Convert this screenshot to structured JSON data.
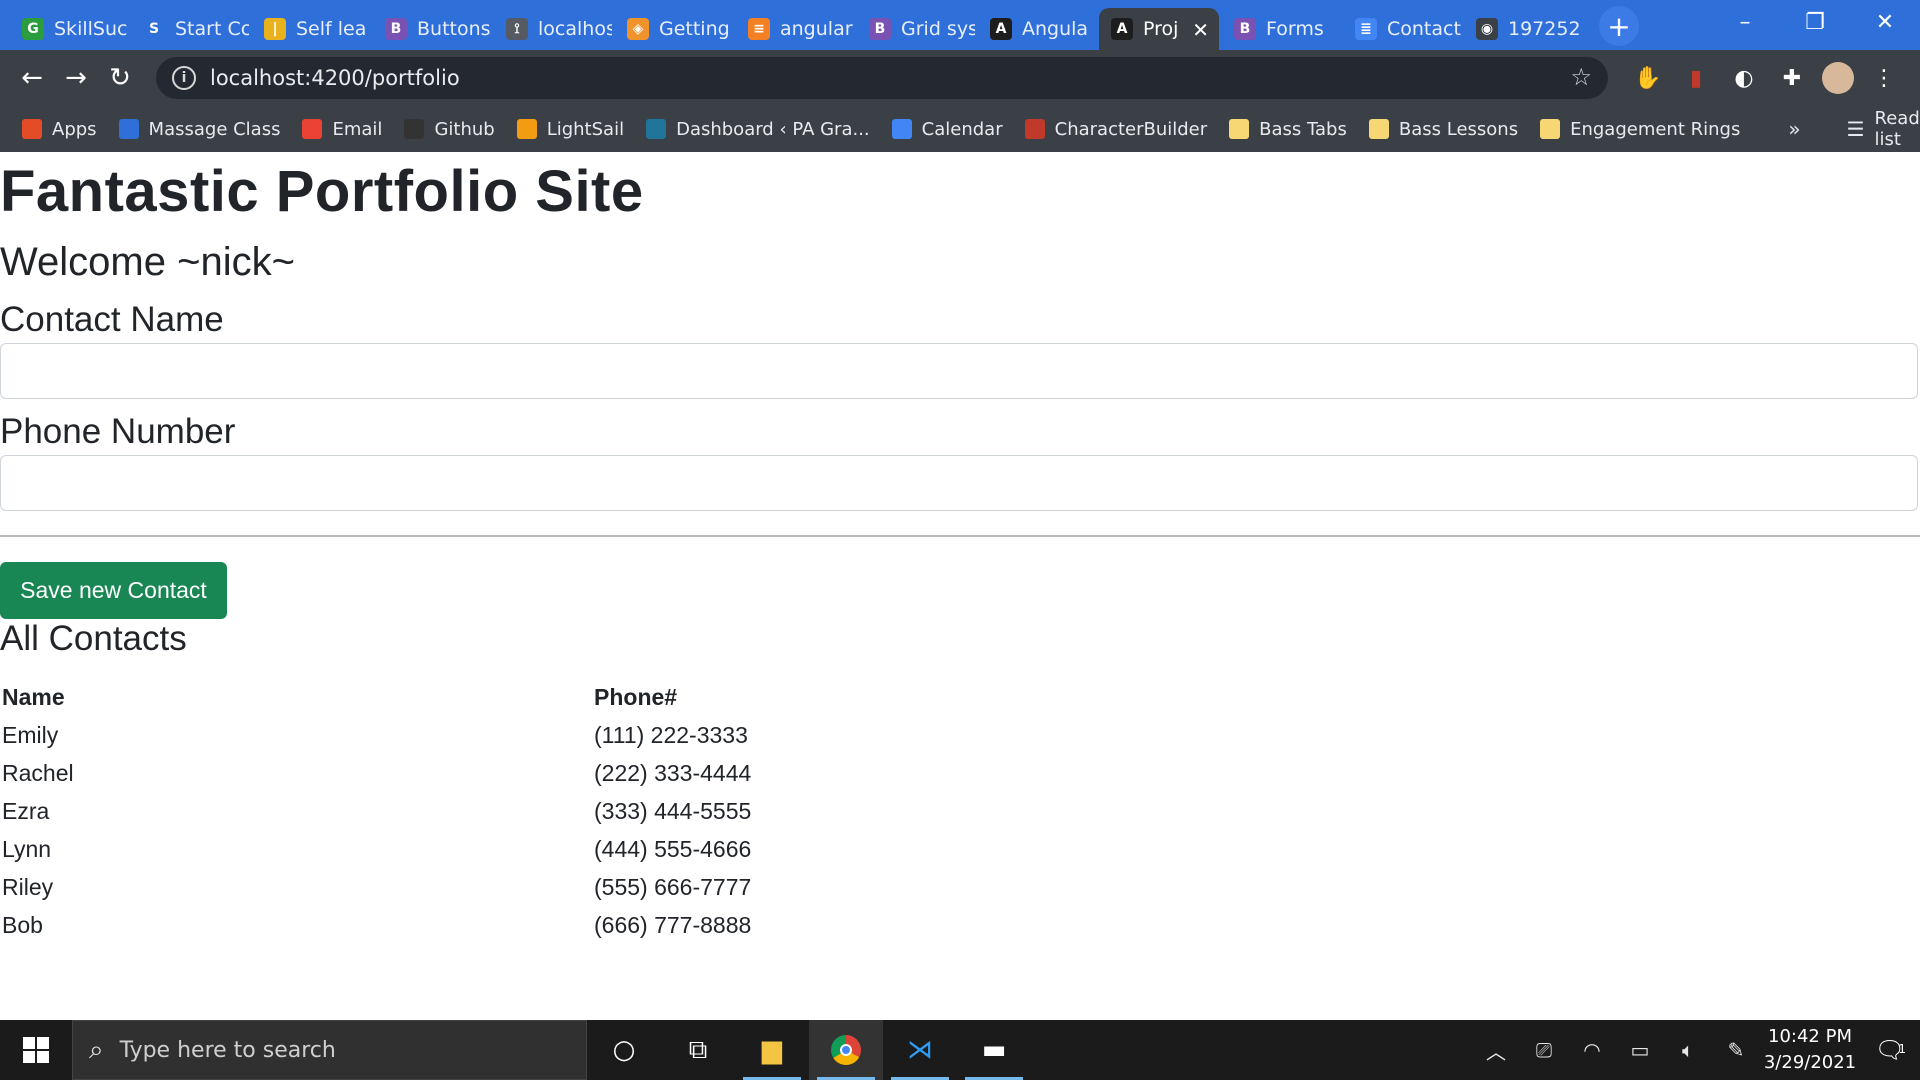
{
  "browser": {
    "tabs": [
      {
        "label": "SkillSuc",
        "favicon_color": "#2a9d3e",
        "favicon_glyph": "G"
      },
      {
        "label": "Start Cc",
        "favicon_color": "#2f6fd9",
        "favicon_glyph": "S"
      },
      {
        "label": "Self lea",
        "favicon_color": "#e8b21f",
        "favicon_glyph": "|"
      },
      {
        "label": "Buttons",
        "favicon_color": "#7952b3",
        "favicon_glyph": "B"
      },
      {
        "label": "localhos",
        "favicon_color": "#555a63",
        "favicon_glyph": "⟟"
      },
      {
        "label": "Getting",
        "favicon_color": "#f0932b",
        "favicon_glyph": "◈"
      },
      {
        "label": "angular",
        "favicon_color": "#f48024",
        "favicon_glyph": "≡"
      },
      {
        "label": "Grid sys",
        "favicon_color": "#7952b3",
        "favicon_glyph": "B"
      },
      {
        "label": "Angula",
        "favicon_color": "#1d1d1d",
        "favicon_glyph": "A"
      },
      {
        "label": "Proj",
        "favicon_color": "#1d1d1d",
        "favicon_glyph": "A",
        "active": true
      },
      {
        "label": "Forms",
        "favicon_color": "#7952b3",
        "favicon_glyph": "B"
      },
      {
        "label": "Contact",
        "favicon_color": "#4285f4",
        "favicon_glyph": "≣"
      },
      {
        "label": "197252",
        "favicon_color": "#3b3f46",
        "favicon_glyph": "◉"
      }
    ],
    "address": "localhost:4200/portfolio",
    "bookmarks": [
      {
        "label": "Apps",
        "icon_color": "#e34c26",
        "icon": "grid-icon"
      },
      {
        "label": "Massage Class",
        "icon_color": "#2f6fd9",
        "icon": "s-icon"
      },
      {
        "label": "Email",
        "icon_color": "#ea4335",
        "icon": "gmail-icon"
      },
      {
        "label": "Github",
        "icon_color": "#333333",
        "icon": "github-icon"
      },
      {
        "label": "LightSail",
        "icon_color": "#f39c12",
        "icon": "cube-icon"
      },
      {
        "label": "Dashboard ‹ PA Gra...",
        "icon_color": "#21759b",
        "icon": "wordpress-icon"
      },
      {
        "label": "Calendar",
        "icon_color": "#4285f4",
        "icon": "calendar-icon"
      },
      {
        "label": "CharacterBuilder",
        "icon_color": "#c0392b",
        "icon": "b-icon"
      },
      {
        "label": "Bass Tabs",
        "icon_color": "#f7d774",
        "icon": "folder-icon"
      },
      {
        "label": "Bass Lessons",
        "icon_color": "#f7d774",
        "icon": "folder-icon"
      },
      {
        "label": "Engagement Rings",
        "icon_color": "#f7d774",
        "icon": "folder-icon"
      }
    ],
    "reading_list": "Reading list"
  },
  "page": {
    "title": "Fantastic Portfolio Site",
    "welcome": "Welcome ~nick~",
    "contact_name_label": "Contact Name",
    "contact_name_value": "",
    "phone_label": "Phone Number",
    "phone_value": "",
    "save_button": "Save new Contact",
    "all_contacts_heading": "All Contacts",
    "table": {
      "headers": [
        "Name",
        "Phone#"
      ],
      "rows": [
        [
          "Emily",
          "(111) 222-3333"
        ],
        [
          "Rachel",
          "(222) 333-4444"
        ],
        [
          "Ezra",
          "(333) 444-5555"
        ],
        [
          "Lynn",
          "(444) 555-4666"
        ],
        [
          "Riley",
          "(555) 666-7777"
        ],
        [
          "Bob",
          "(666) 777-8888"
        ]
      ]
    },
    "colors": {
      "save_button": "#198754"
    }
  },
  "taskbar": {
    "search_placeholder": "Type here to search",
    "time": "10:42 PM",
    "date": "3/29/2021",
    "notification_count": "1"
  }
}
